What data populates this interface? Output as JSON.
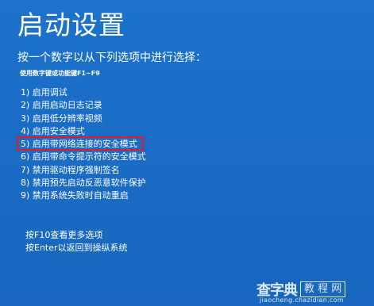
{
  "window": {
    "title": "启动设置"
  },
  "prompt": {
    "instruction": "按一个数字以从下列选项中进行选择：",
    "hint": "使用数字键或功能键F1~F9"
  },
  "options": [
    {
      "label": "1) 启用调试"
    },
    {
      "label": "2) 启用启动日志记录"
    },
    {
      "label": "3) 启用低分辨率视频"
    },
    {
      "label": "4) 启用安全模式"
    },
    {
      "label": "5) 启用带网络连接的安全模式",
      "highlighted": true
    },
    {
      "label": "6) 启用带命令提示符的安全模式"
    },
    {
      "label": "7) 禁用驱动程序强制签名"
    },
    {
      "label": "8) 禁用预先启动反恶意软件保护"
    },
    {
      "label": "9) 禁用系统失败时自动重启"
    }
  ],
  "footer": {
    "more_options": "按F10查看更多选项",
    "return": "按Enter以返回到操纵系统"
  },
  "watermark": {
    "brand": "查字典",
    "box_text": "教 程 网",
    "url": "jiaocheng.chazidian.com"
  },
  "colors": {
    "background": "#1a6fc9",
    "text": "#ffffff",
    "highlight_border": "#e51b24"
  }
}
